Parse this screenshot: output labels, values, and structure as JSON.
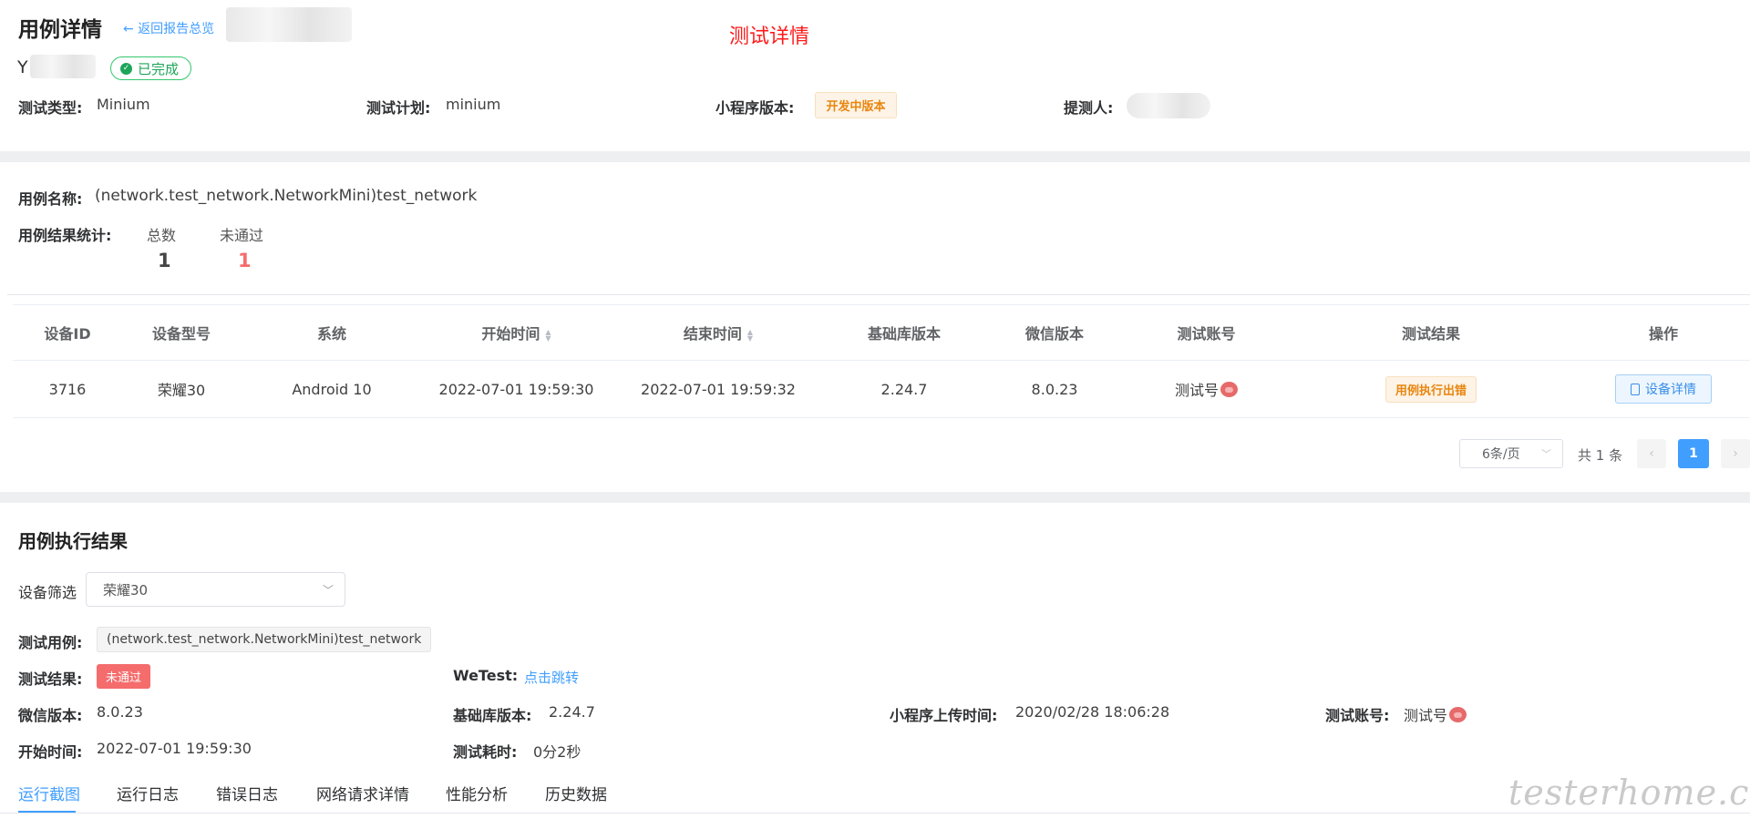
{
  "header": {
    "page_title": "用例详情",
    "back_link": "← 返回报告总览",
    "annotation": "测试详情",
    "name_prefix": "Y",
    "status": "已完成"
  },
  "info": {
    "type_label": "测试类型:",
    "type_value": "Minium",
    "plan_label": "测试计划:",
    "plan_value": "minium",
    "version_label": "小程序版本:",
    "version_value": "开发中版本",
    "submitter_label": "提测人:"
  },
  "case": {
    "name_label": "用例名称:",
    "name_value": "(network.test_network.NetworkMini)test_network",
    "stats_label": "用例结果统计:",
    "total_label": "总数",
    "total_value": "1",
    "failed_label": "未通过",
    "failed_value": "1"
  },
  "table": {
    "columns": [
      "设备ID",
      "设备型号",
      "系统",
      "开始时间",
      "结束时间",
      "基础库版本",
      "微信版本",
      "测试账号",
      "测试结果",
      "操作"
    ],
    "rows": [
      {
        "device_id": "3716",
        "model": "荣耀30",
        "system": "Android 10",
        "start": "2022-07-01 19:59:30",
        "end": "2022-07-01 19:59:32",
        "lib_version": "2.24.7",
        "wechat_version": "8.0.23",
        "account": "测试号",
        "result": "用例执行出错",
        "action": "设备详情"
      }
    ]
  },
  "pagination": {
    "page_size": "6条/页",
    "total": "共 1 条",
    "current": "1"
  },
  "result_section": {
    "title": "用例执行结果",
    "device_filter_label": "设备筛选",
    "device_filter_value": "荣耀30",
    "case_label": "测试用例:",
    "case_value": "(network.test_network.NetworkMini)test_network",
    "result_label": "测试结果:",
    "result_value": "未通过",
    "wetest_label": "WeTest:",
    "wetest_link": "点击跳转",
    "wechat_label": "微信版本:",
    "wechat_value": "8.0.23",
    "lib_label": "基础库版本:",
    "lib_value": "2.24.7",
    "upload_label": "小程序上传时间:",
    "upload_value": "2020/02/28 18:06:28",
    "account_label": "测试账号:",
    "account_value": "测试号",
    "start_label": "开始时间:",
    "start_value": "2022-07-01 19:59:30",
    "duration_label": "测试耗时:",
    "duration_value": "0分2秒"
  },
  "tabs": [
    "运行截图",
    "运行日志",
    "错误日志",
    "网络请求详情",
    "性能分析",
    "历史数据"
  ],
  "watermark": "testerhome.com",
  "colors": {
    "accent": "#409eff",
    "success": "#1ea55a",
    "danger": "#f56c6c",
    "warning": "#e8860f",
    "annotation": "#ff1a1a"
  }
}
